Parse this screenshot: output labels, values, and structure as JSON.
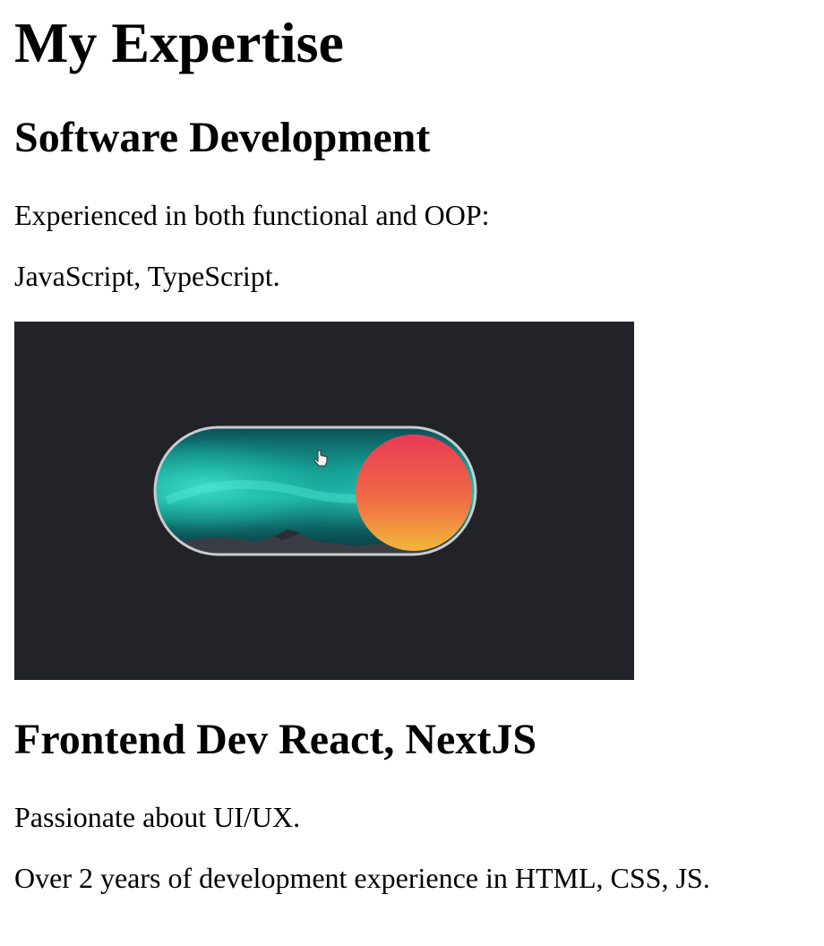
{
  "page": {
    "title": "My Expertise"
  },
  "sections": [
    {
      "heading": "Software Development",
      "paragraphs": [
        "Experienced in both functional and OOP:",
        "JavaScript, TypeScript."
      ]
    },
    {
      "heading": "Frontend Dev React, NextJS",
      "paragraphs": [
        "Passionate about UI/UX.",
        "Over 2 years of development experience in HTML, CSS, JS."
      ]
    }
  ],
  "media": {
    "kind": "toggle-switch-animation",
    "background_color": "#212329",
    "knob_gradient": [
      "#e83a57",
      "#f0b33a"
    ],
    "track_color": "#1ba89c",
    "toggle_state": "on"
  }
}
